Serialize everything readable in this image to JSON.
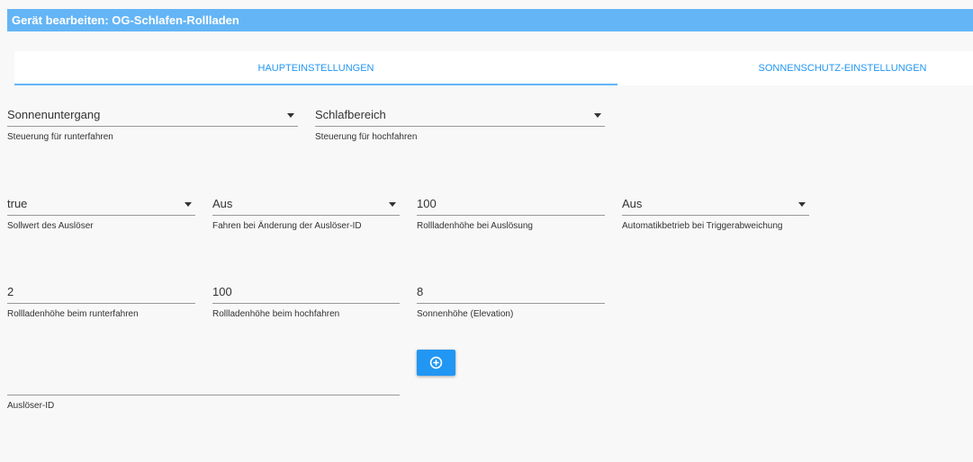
{
  "dialog": {
    "title": "Gerät bearbeiten: OG-Schlafen-Rollladen"
  },
  "tabs": {
    "main": "HAUPTEINSTELLUNGEN",
    "sunprotect": "SONNENSCHUTZ-EINSTELLUNGEN"
  },
  "fields": {
    "down_control": {
      "value": "Sonnenuntergang",
      "label": "Steuerung für runterfahren"
    },
    "up_control": {
      "value": "Schlafbereich",
      "label": "Steuerung für hochfahren"
    },
    "trigger_setpoint": {
      "value": "true",
      "label": "Sollwert des Auslöser"
    },
    "drive_on_trigger_change": {
      "value": "Aus",
      "label": "Fahren bei Änderung der Auslöser-ID"
    },
    "height_on_trigger": {
      "value": "100",
      "label": "Rollladenhöhe bei Auslösung"
    },
    "auto_on_trigger_deviation": {
      "value": "Aus",
      "label": "Automatikbetrieb bei Triggerabweichung"
    },
    "height_down": {
      "value": "2",
      "label": "Rollladenhöhe beim runterfahren"
    },
    "height_up": {
      "value": "100",
      "label": "Rollladenhöhe beim hochfahren"
    },
    "sun_elevation": {
      "value": "8",
      "label": "Sonnenhöhe (Elevation)"
    },
    "trigger_id": {
      "value": "",
      "label": "Auslöser-ID"
    }
  },
  "icons": {
    "add": "plus-circle-icon",
    "dropdown": "caret-down-icon"
  },
  "colors": {
    "title_bar": "#64b5f6",
    "accent": "#2196f3",
    "tab_bg": "#ffffff",
    "page_bg": "#f8f8f8"
  }
}
